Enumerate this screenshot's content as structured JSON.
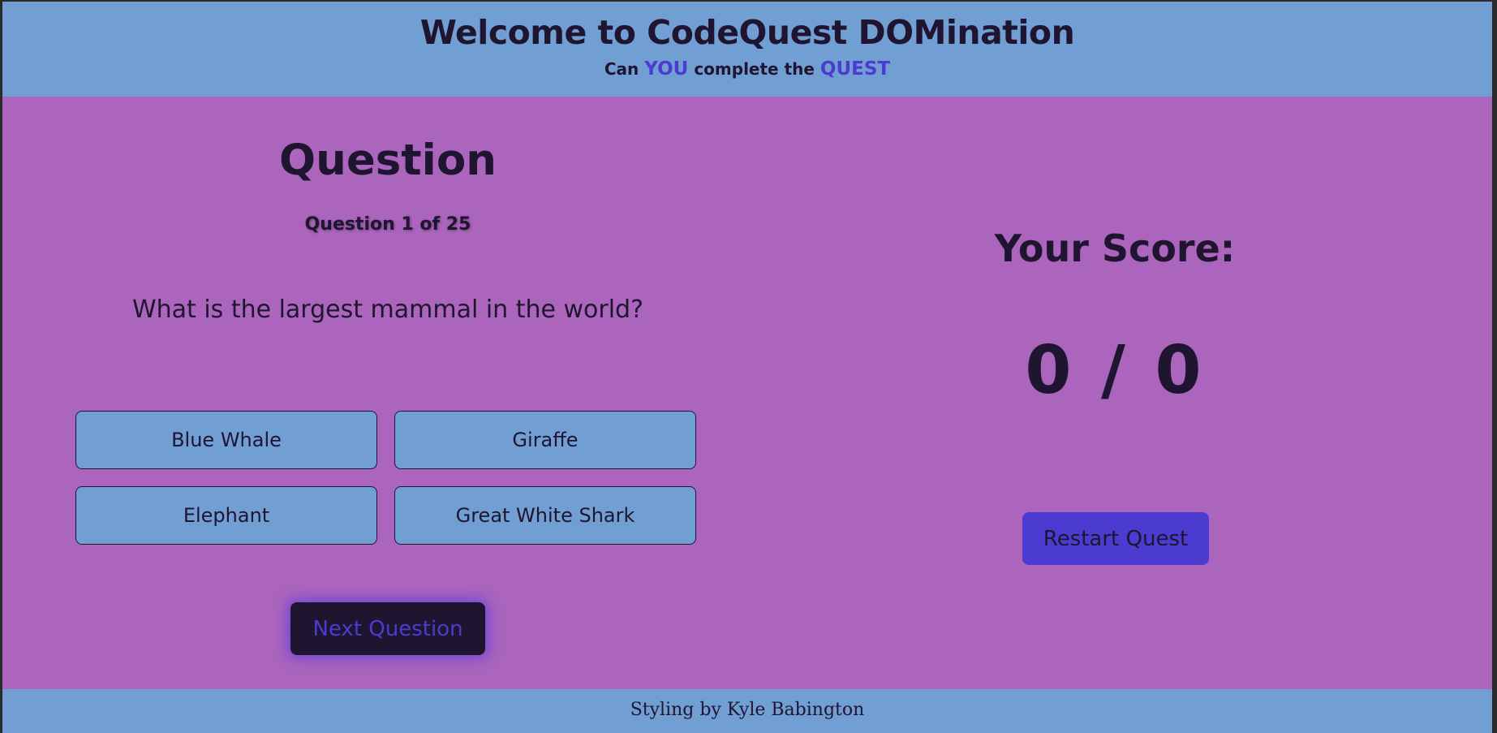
{
  "header": {
    "title": "Welcome to CodeQuest DOMination",
    "subtitle_prefix": "Can",
    "subtitle_you": "YOU",
    "subtitle_middle": "complete the",
    "subtitle_quest": "QUEST"
  },
  "question": {
    "heading": "Question",
    "counter": "Question 1 of 25",
    "text": "What is the largest mammal in the world?",
    "answers": [
      "Blue Whale",
      "Giraffe",
      "Elephant",
      "Great White Shark"
    ],
    "next_label": "Next Question"
  },
  "score": {
    "heading": "Your Score:",
    "value": "0 / 0",
    "restart_label": "Restart Quest"
  },
  "footer": {
    "credit": "Styling by Kyle Babington"
  },
  "colors": {
    "header_bg": "#719ed3",
    "body_bg": "#ab65bc",
    "text_dark": "#1f1530",
    "accent": "#4b3bd0"
  }
}
